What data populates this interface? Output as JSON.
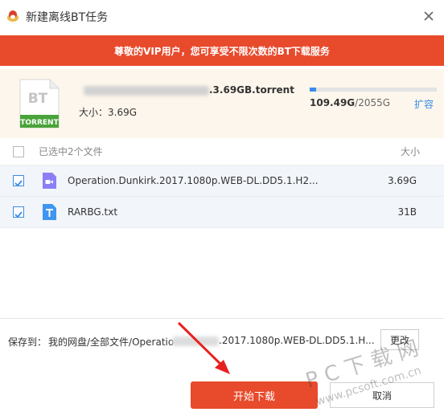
{
  "window": {
    "title": "新建离线BT任务",
    "close_icon": "close-icon"
  },
  "banner": {
    "text": "尊敬的VIP用户，您可享受不限次数的BT下载服务",
    "color": "#e84a2c"
  },
  "torrent": {
    "icon_label_top": "BT",
    "icon_label_bottom": "TORRENT",
    "name_suffix": ".3.69GB.torrent",
    "size_text": "大小：3.69G"
  },
  "quota": {
    "used": "109.49G",
    "total": "/2055G",
    "used_fraction": 0.053,
    "expand_label": "扩容"
  },
  "list": {
    "header_label": "已选中2个文件",
    "size_header": "大小",
    "files": [
      {
        "name": "Operation.Dunkirk.2017.1080p.WEB-DL.DD5.1.H2...",
        "size": "3.69G",
        "type_icon": "video-icon",
        "checked": true
      },
      {
        "name": "RARBG.txt",
        "size": "31B",
        "type_icon": "text-file-icon",
        "checked": true
      }
    ]
  },
  "save": {
    "label": "保存到：",
    "path_prefix": "我的网盘/全部文件/Operatio",
    "path_suffix": ".2017.1080p.WEB-DL.DD5.1.H...",
    "change_label": "更改"
  },
  "actions": {
    "start_label": "开始下载",
    "cancel_label": "取消"
  },
  "watermark": {
    "line1": "P C 下 载 网",
    "line2": "www.pcsoft.com.cn"
  },
  "colors": {
    "accent_red": "#e84a2c",
    "accent_blue": "#3a8ce6"
  }
}
